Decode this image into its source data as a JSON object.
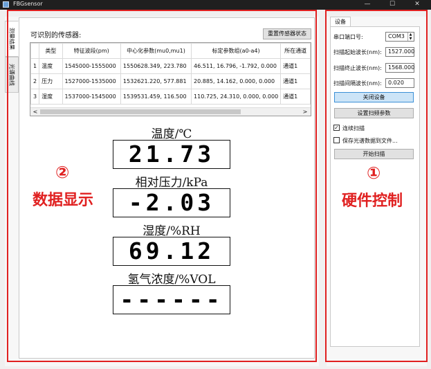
{
  "window": {
    "title": "FBGsensor",
    "minimize_glyph": "—",
    "maximize_glyph": "☐",
    "close_glyph": "✕"
  },
  "left_tabs": [
    {
      "label": "测量结果"
    },
    {
      "label": "光谱曲线"
    }
  ],
  "sensors_panel": {
    "title": "可识别的传感器:",
    "reset_button": "重置传感器状态",
    "columns": [
      "",
      "类型",
      "特征波段(pm)",
      "中心化参数(mu0,mu1)",
      "标定参数组(a0-a4)",
      "所在通道"
    ],
    "rows": [
      [
        "1",
        "温度",
        "1545000-1555000",
        "1550628.349, 223.780",
        "46.511, 16.796, -1.792, 0.000",
        "通道1"
      ],
      [
        "2",
        "压力",
        "1527000-1535000",
        "1532621.220, 577.881",
        "20.885, 14.162, 0.000, 0.000",
        "通道1"
      ],
      [
        "3",
        "湿度",
        "1537000-1545000",
        "1539531.459, 116.500",
        "110.725, 24.310, 0.000, 0.000",
        "通道1"
      ]
    ],
    "scroll_left": "<",
    "scroll_right": ">"
  },
  "readouts": [
    {
      "label": "温度/℃",
      "value": "21.73"
    },
    {
      "label": "相对压力/kPa",
      "value": "-2.03"
    },
    {
      "label": "湿度/%RH",
      "value": "69.12"
    },
    {
      "label": "氢气浓度/%VOL",
      "value": "------"
    }
  ],
  "device_panel": {
    "tab": "设备",
    "port_label": "串口端口号:",
    "port_value": "COM3",
    "start_wl_label": "扫描起始波长(nm):",
    "start_wl_value": "1527.000",
    "end_wl_label": "扫描终止波长(nm):",
    "end_wl_value": "1568.000",
    "step_label": "扫描间隔波长(nm):",
    "step_value": "0.020",
    "close_device_button": "关闭设备",
    "set_params_button": "设置扫频参数",
    "continuous_scan_label": "连续扫描",
    "continuous_scan_checked": true,
    "save_spectrum_label": "保存光谱数据到文件...",
    "save_spectrum_checked": false,
    "start_scan_button": "开始扫描"
  },
  "annotations": {
    "left_number": "②",
    "left_text": "数据显示",
    "right_number": "①",
    "right_text": "硬件控制",
    "color": "#e02020"
  }
}
